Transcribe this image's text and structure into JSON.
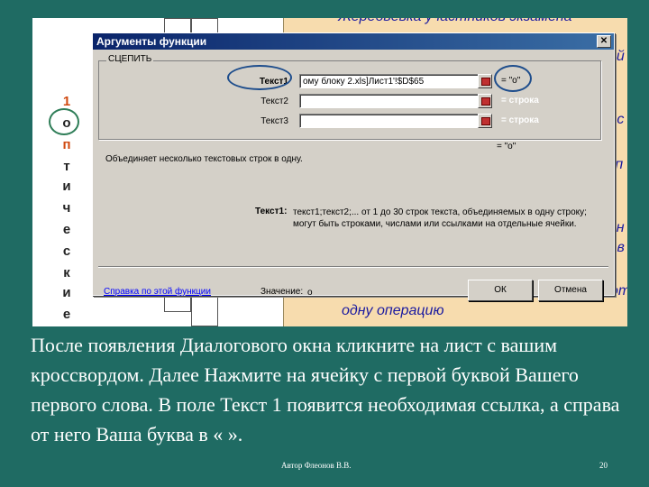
{
  "background": {
    "orange_panel_top_text": "Жеребьёвка участников экзамена",
    "orange_panel_fragments": [
      "ий",
      "е с",
      "о п",
      "нн",
      "л в",
      "от"
    ],
    "orange_panel_bottom_text": "одну операцию",
    "column_letters": [
      "1",
      "о",
      "п",
      "т",
      "и",
      "ч",
      "е",
      "с",
      "к",
      "и",
      "е"
    ]
  },
  "dialog": {
    "title": "Аргументы функции",
    "close_glyph": "✕",
    "function_name": "СЦЕПИТЬ",
    "args": [
      {
        "label": "Текст1",
        "value": "ому блоку 2.xls]Лист1'!$D$65",
        "result": "= \"о\""
      },
      {
        "label": "Текст2",
        "value": "",
        "result": "= строка"
      },
      {
        "label": "Текст3",
        "value": "",
        "result": "= строка"
      }
    ],
    "formula_result": "= \"о\"",
    "description": "Объединяет несколько текстовых строк в одну.",
    "help_arg_label": "Текст1:",
    "help_arg_text": "текст1;текст2;... от 1 до 30 строк текста, объединяемых в одну строку; могут быть строками, числами или ссылками на отдельные ячейки.",
    "help_link": "Справка по этой функции",
    "value_label": "Значение:",
    "value": "о",
    "ok_label": "ОК",
    "cancel_label": "Отмена"
  },
  "caption": "После появления Диалогового окна кликните на лист с вашим кроссвордом. Далее Нажмите на ячейку с первой буквой Вашего первого слова. В поле Текст 1 появится необходимая ссылка, а справа от него Ваша буква в « ».",
  "footer": {
    "author": "Автор Флеонов В.В.",
    "page": "20"
  },
  "colors": {
    "slide_background": "#1f6b63",
    "dialog_face": "#d4d0c8",
    "titlebar": "#0a246a",
    "orange_panel": "#f7dcae",
    "highlight_ellipse": "#1e4d8c"
  }
}
